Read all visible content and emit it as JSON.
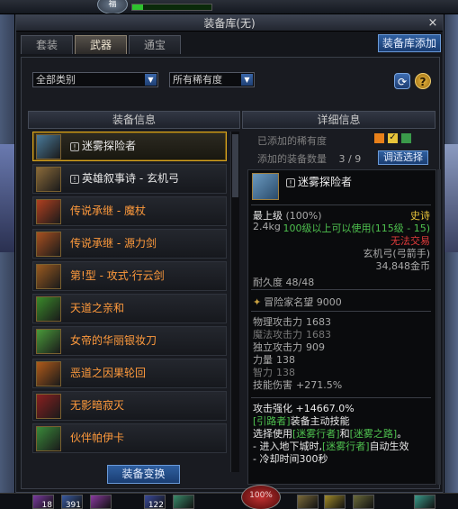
{
  "window": {
    "title": "装备库(无)",
    "close_glyph": "×",
    "tabs": [
      {
        "label": "套装",
        "active": false
      },
      {
        "label": "武器",
        "active": true
      },
      {
        "label": "通宝",
        "active": false
      }
    ],
    "add_button": "装备库添加"
  },
  "filters": {
    "category": "全部类别",
    "rarity": "所有稀有度"
  },
  "list_header": "装备信息",
  "detail_header": "详细信息",
  "items": [
    {
      "label": "迷雾探险者",
      "tag": "!",
      "color": "white",
      "selected": true,
      "icon": "bow-weapon-icon",
      "icon_color": "#4a7a9a"
    },
    {
      "label": "英雄叙事诗 - 玄机弓",
      "tag": "!",
      "color": "white",
      "selected": false,
      "icon": "bow-weapon-icon",
      "icon_color": "#8a6a3a"
    },
    {
      "label": "传说承继 - 魔杖",
      "tag": "",
      "color": "orange",
      "selected": false,
      "icon": "wand-weapon-icon",
      "icon_color": "#b04020"
    },
    {
      "label": "传说承继 - 源力剑",
      "tag": "",
      "color": "orange",
      "selected": false,
      "icon": "sword-weapon-icon",
      "icon_color": "#a85020"
    },
    {
      "label": "第!型 - 攻式·行云剑",
      "tag": "",
      "color": "orange",
      "selected": false,
      "icon": "sword-weapon-icon",
      "icon_color": "#9a5a20"
    },
    {
      "label": "天道之亲和",
      "tag": "",
      "color": "orange",
      "selected": false,
      "icon": "staff-weapon-icon",
      "icon_color": "#3a8a2a"
    },
    {
      "label": "女帝的华丽银妆刀",
      "tag": "",
      "color": "orange",
      "selected": false,
      "icon": "blade-weapon-icon",
      "icon_color": "#4a9a3a"
    },
    {
      "label": "恶道之因果轮回",
      "tag": "",
      "color": "orange",
      "selected": false,
      "icon": "claw-weapon-icon",
      "icon_color": "#b05a1a"
    },
    {
      "label": "无影暗寂灭",
      "tag": "",
      "color": "orange",
      "selected": false,
      "icon": "dagger-weapon-icon",
      "icon_color": "#8a2020"
    },
    {
      "label": "伙伴帕伊卡",
      "tag": "",
      "color": "orange",
      "selected": false,
      "icon": "pet-weapon-icon",
      "icon_color": "#3a8a3a"
    }
  ],
  "swap_button": "装备变换",
  "detail": {
    "rarity_label": "已添加的稀有度",
    "count_label": "添加的装备数量",
    "count_value": "3 / 9",
    "pick_button": "调适选择",
    "rarity_colors": [
      "#e8801a",
      "#e8c43a",
      "#3a9a4a"
    ],
    "item_name": "迷雾探险者",
    "item_tag": "!",
    "grade": "最上级",
    "grade_pct": "(100%)",
    "rarity": "史诗",
    "weight": "2.4kg",
    "req": "100级以上可以使用(115级 - 15)",
    "trade": "无法交易",
    "type": "玄机弓(弓箭手)",
    "price": "34,848金币",
    "durability": "耐久度 48/48",
    "fame": "冒险家名望 9000",
    "stats": [
      {
        "label": "物理攻击力",
        "value": "1683",
        "dim": false
      },
      {
        "label": "魔法攻击力",
        "value": "1683",
        "dim": true
      },
      {
        "label": "独立攻击力",
        "value": "909",
        "dim": false
      },
      {
        "label": "力量",
        "value": "138",
        "dim": false
      },
      {
        "label": "智力",
        "value": "138",
        "dim": true
      },
      {
        "label": "技能伤害",
        "value": "+271.5%",
        "dim": false
      }
    ],
    "attack_boost": "攻击强化 +14667.0%",
    "skill_line1_a": "[引路者]",
    "skill_line1_b": "装备主动技能",
    "skill_line2_a": "选择使用",
    "skill_line2_b": "[迷雾行者]",
    "skill_line2_c": "和",
    "skill_line2_d": "[迷雾之路]",
    "skill_line2_e": "。",
    "skill_line3_a": "- 进入地下城时,",
    "skill_line3_b": "[迷雾行者]",
    "skill_line3_c": "自动生效",
    "skill_line4": "- 冷却时间300秒"
  },
  "hud": {
    "top_orb": "福",
    "mp_pct": "100%",
    "slots": [
      "18",
      "391",
      "",
      "122",
      "",
      "",
      "",
      "",
      ""
    ]
  }
}
